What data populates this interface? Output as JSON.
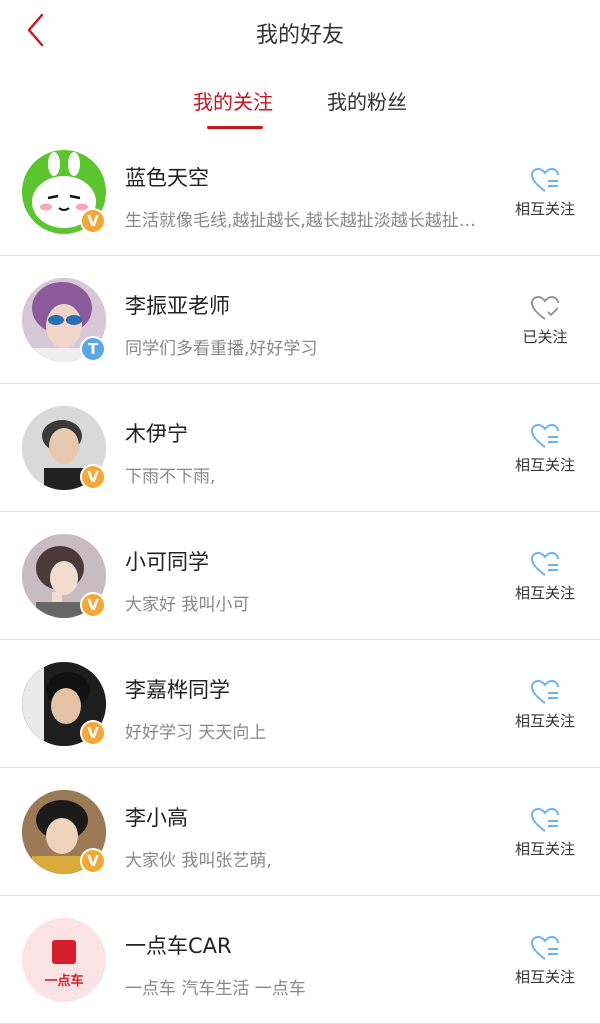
{
  "header": {
    "title": "我的好友"
  },
  "tabs": [
    {
      "label": "我的关注",
      "active": true
    },
    {
      "label": "我的粉丝",
      "active": false
    }
  ],
  "colors": {
    "accent": "#c8161d",
    "heart_mutual": "#6fb3e0",
    "heart_followed": "#999999"
  },
  "friends": [
    {
      "name": "蓝色天空",
      "signature": "生活就像毛线,越扯越长,越长越扯淡越长越扯…",
      "badge": "V",
      "status": "相互关注",
      "avatar": "green-bunny"
    },
    {
      "name": "李振亚老师",
      "signature": "同学们多看重播,好好学习",
      "badge": "T",
      "status": "已关注",
      "avatar": "girl-sunglasses"
    },
    {
      "name": "木伊宁",
      "signature": "下雨不下雨,",
      "badge": "V",
      "status": "相互关注",
      "avatar": "young-man"
    },
    {
      "name": "小可同学",
      "signature": "大家好 我叫小可",
      "badge": "V",
      "status": "相互关注",
      "avatar": "girl"
    },
    {
      "name": "李嘉桦同学",
      "signature": "好好学习 天天向上",
      "badge": "V",
      "status": "相互关注",
      "avatar": "young-man-dark"
    },
    {
      "name": "李小高",
      "signature": "大家伙 我叫张艺萌,",
      "badge": "V",
      "status": "相互关注",
      "avatar": "boy-hair"
    },
    {
      "name": "一点车CAR",
      "signature": "一点车 汽车生活 一点车",
      "badge": "",
      "status": "相互关注",
      "avatar": "logo-car",
      "logo_text": "一点车"
    }
  ]
}
